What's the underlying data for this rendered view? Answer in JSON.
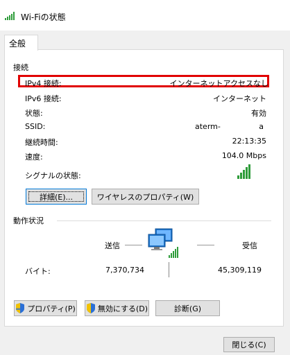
{
  "window": {
    "title": "Wi-Fiの状態"
  },
  "tabs": [
    {
      "label": "全般"
    }
  ],
  "connection": {
    "section_title": "接続",
    "rows": [
      {
        "label": "IPv4 接続:",
        "value": "インターネットアクセスなし"
      },
      {
        "label": "IPv6 接続:",
        "value": "インターネット"
      },
      {
        "label": "状態:",
        "value": "有効"
      },
      {
        "label": "SSID:",
        "value": "aterm-",
        "value_suffix": "a"
      },
      {
        "label": "継続時間:",
        "value": "22:13:35"
      },
      {
        "label": "速度:",
        "value": "104.0 Mbps"
      }
    ],
    "signal_label": "シグナルの状態:",
    "signal_level_bars": 5,
    "details_button": "詳細(E)...",
    "wireless_properties_button": "ワイヤレスのプロパティ(W)"
  },
  "activity": {
    "section_title": "動作状況",
    "sent_label": "送信",
    "received_label": "受信",
    "bytes_label": "バイト:",
    "bytes_sent": "7,370,734",
    "bytes_received": "45,309,119"
  },
  "buttons": {
    "properties": "プロパティ(P)",
    "disable": "無効にする(D)",
    "diagnose": "診断(G)",
    "close": "閉じる(C)"
  },
  "colors": {
    "signal": "#2e9c3a",
    "highlight": "#e10000",
    "focus": "#0078d7"
  }
}
